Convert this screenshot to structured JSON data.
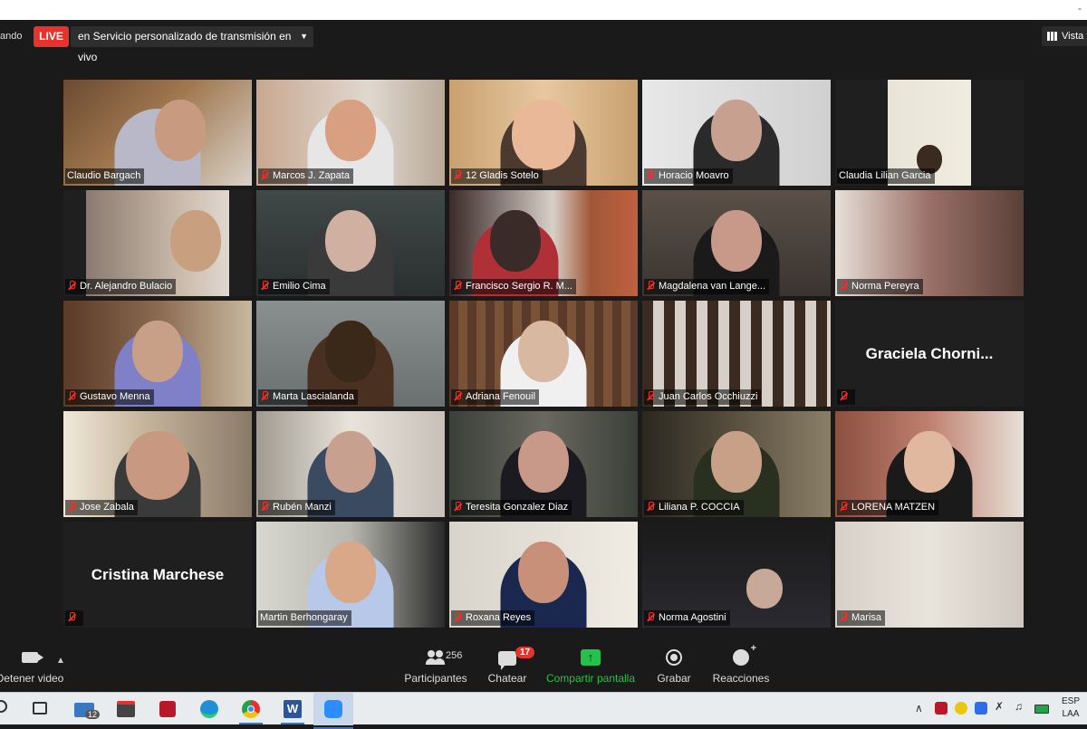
{
  "window": {
    "top_dash": "-"
  },
  "header": {
    "streaming_partial": "ando",
    "live_label": "LIVE",
    "live_service": "en Servicio personalizado de transmisión en vivo",
    "view_label": "Vista"
  },
  "tiles": [
    {
      "name": "Claudio Bargach",
      "muted": false
    },
    {
      "name": "Marcos J. Zapata",
      "muted": true
    },
    {
      "name": "12 Gladis Sotelo",
      "muted": true
    },
    {
      "name": "Horacio Moavro",
      "muted": true
    },
    {
      "name": "Claudia Lilian Garcia",
      "muted": false
    },
    {
      "name": "Dr. Alejandro Bulacio",
      "muted": true
    },
    {
      "name": "Emilio Cima",
      "muted": true
    },
    {
      "name": "Francisco Sergio R. M...",
      "muted": true
    },
    {
      "name": "Magdalena van Lange...",
      "muted": true
    },
    {
      "name": "Norma Pereyra",
      "muted": true
    },
    {
      "name": "Gustavo Menna",
      "muted": true
    },
    {
      "name": "Marta Lascialanda",
      "muted": true
    },
    {
      "name": "Adriana Fenouil",
      "muted": true
    },
    {
      "name": "Juan Carlos Occhiuzzi",
      "muted": true
    },
    {
      "name": "",
      "muted": true,
      "big_name": "Graciela   Chorni..."
    },
    {
      "name": "Jose Zabala",
      "muted": true
    },
    {
      "name": "Rubén Manzi",
      "muted": true
    },
    {
      "name": "Teresita Gonzalez Diaz",
      "muted": true
    },
    {
      "name": "Liliana P. COCCIA",
      "muted": true
    },
    {
      "name": "LORENA MATZEN",
      "muted": true
    },
    {
      "name": "",
      "muted": true,
      "big_name": "Cristina Marchese"
    },
    {
      "name": "Martin Berhongaray",
      "muted": false
    },
    {
      "name": "Roxana Reyes",
      "muted": true
    },
    {
      "name": "Norma Agostini",
      "muted": true
    },
    {
      "name": "Marisa",
      "muted": true
    }
  ],
  "toolbar": {
    "video_label": "Detener video",
    "participants_label": "Participantes",
    "participants_count": "256",
    "chat_label": "Chatear",
    "chat_badge": "17",
    "share_label": "Compartir pantalla",
    "record_label": "Grabar",
    "reactions_label": "Reacciones"
  },
  "taskbar": {
    "mail_badge": "12",
    "lang_line1": "ESP",
    "lang_line2": "LAA"
  },
  "colors": {
    "live": "#e8322b",
    "share": "#24c24a",
    "active_speaker": "#e8e85a"
  }
}
